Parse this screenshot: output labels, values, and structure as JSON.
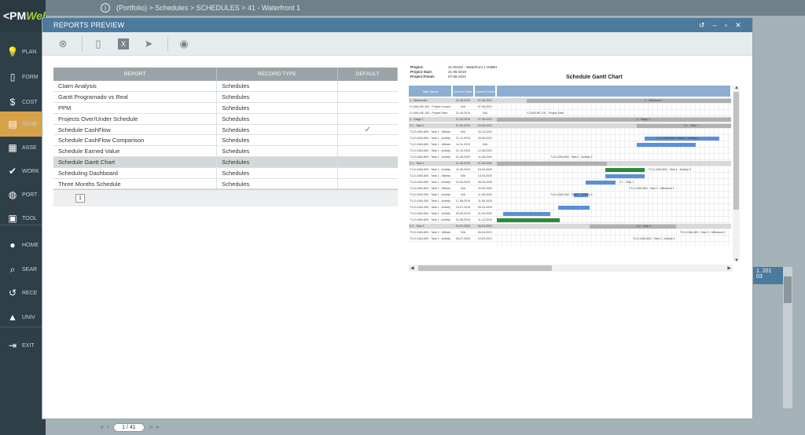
{
  "app": {
    "logo_left": "<PM",
    "logo_right": "Web",
    "breadcrumb": "(Portfolio) > Schedules > SCHEDULES > 41 - Waterfront 1"
  },
  "nav": [
    {
      "label": "PLAN",
      "icon": "lightbulb-icon",
      "glyph": "💡"
    },
    {
      "label": "FORM",
      "icon": "document-icon",
      "glyph": "▯"
    },
    {
      "label": "COST",
      "icon": "dollar-icon",
      "glyph": "$"
    },
    {
      "label": "SCHE",
      "icon": "schedule-icon",
      "glyph": "▤"
    },
    {
      "label": "ASSE",
      "icon": "asset-icon",
      "glyph": "▦"
    },
    {
      "label": "WORK",
      "icon": "checkmark-icon",
      "glyph": "✔"
    },
    {
      "label": "PORT",
      "icon": "globe-icon",
      "glyph": "◍"
    },
    {
      "label": "TOOL",
      "icon": "toolbox-icon",
      "glyph": "▣"
    },
    {
      "label": "HOME",
      "icon": "avatar-icon",
      "glyph": "●"
    },
    {
      "label": "SEAR",
      "icon": "search-icon",
      "glyph": "⌕"
    },
    {
      "label": "RECE",
      "icon": "history-icon",
      "glyph": "↺"
    },
    {
      "label": "UNIV",
      "icon": "graduation-icon",
      "glyph": "▲"
    },
    {
      "label": "EXIT",
      "icon": "exit-icon",
      "glyph": "⇥"
    }
  ],
  "background": {
    "pager_text": "1 / 41",
    "grid_cell_top": "1. 201",
    "grid_cell_bottom": "03"
  },
  "modal": {
    "title": "REPORTS PREVIEW",
    "window_controls": [
      "↺",
      "–",
      "▫",
      "✕"
    ],
    "toolbar": [
      {
        "name": "cancel-icon",
        "glyph": "⊗"
      },
      {
        "name": "pdf-icon",
        "glyph": "▯"
      },
      {
        "name": "excel-icon",
        "glyph": "X"
      },
      {
        "name": "send-icon",
        "glyph": "➤"
      },
      {
        "name": "preview-eye-icon",
        "glyph": "◉"
      }
    ]
  },
  "reports_table": {
    "headers": [
      "REPORT",
      "RECORD TYPE",
      "DEFAULT"
    ],
    "rows": [
      {
        "report": "Claim Analysis",
        "type": "Schedules",
        "default": ""
      },
      {
        "report": "Gantt Programado vs Real",
        "type": "Schedules",
        "default": ""
      },
      {
        "report": "PPM",
        "type": "Schedules",
        "default": ""
      },
      {
        "report": "Projects Over/Under Schedule",
        "type": "Schedules",
        "default": ""
      },
      {
        "report": "Schedule CashFlow",
        "type": "Schedules",
        "default": "✓"
      },
      {
        "report": "Schedule CashFlow Comparison",
        "type": "Schedules",
        "default": ""
      },
      {
        "report": "Schedule Earned Value",
        "type": "Schedules",
        "default": ""
      },
      {
        "report": "Schedule Gantt Chart",
        "type": "Schedules",
        "default": ""
      },
      {
        "report": "Scheduling Dashboard",
        "type": "Schedules",
        "default": ""
      },
      {
        "report": "Three Months Schedule",
        "type": "Schedules",
        "default": ""
      }
    ],
    "selected_index": 7,
    "page": "1"
  },
  "preview": {
    "meta": [
      {
        "label": "Project:",
        "value": "41-00162 - Waterfront 1 GMBH"
      },
      {
        "label": "Project Start:",
        "value": "21-05-2019"
      },
      {
        "label": "Project Finish:",
        "value": "07-08-2021"
      }
    ],
    "title": "Schedule Gantt Chart",
    "col_headers": [
      "Task Name",
      "Current Start",
      "Current Finish"
    ],
    "rows": [
      {
        "name": "1 - Milestones",
        "start": "21-05-2019",
        "finish": "07-08-2021",
        "group": true
      },
      {
        "name": "G-GAN-NE-100 - Project Completion",
        "start": "N/A",
        "finish": "07-08-2021",
        "group": false
      },
      {
        "name": "G-GAN-NE-100 - Project Start",
        "start": "21-05-2019",
        "finish": "N/A",
        "group": false
      },
      {
        "name": "2 - Stage 1",
        "start": "27-02-2019",
        "finish": "07-08-2021",
        "group": true
      },
      {
        "name": "2.1 - Task 1",
        "start": "21-02-2019",
        "finish": "04-05-2021",
        "group": true
      },
      {
        "name": "T1-D-GAN-800 - Task 1 - Milestone 1",
        "start": "N/A",
        "finish": "22-12-2021",
        "group": false
      },
      {
        "name": "T1-D-GAN-800 - Task 1 - Activity 1",
        "start": "21-11-2019",
        "finish": "25-06-2021",
        "group": false
      },
      {
        "name": "T1-D-GAN-800 - Task 1 - Milestone 2",
        "start": "14-11-2019",
        "finish": "N/A",
        "group": false
      },
      {
        "name": "T1-D-GAN-800 - Task 1 - Activity 2",
        "start": "01-10-2020",
        "finish": "12-08-2020",
        "group": false
      },
      {
        "name": "T1-D-GAN-800 - Task 1 - Activity 3",
        "start": "01-05-2020",
        "finish": "11-06-2020",
        "group": false
      },
      {
        "name": "2.1 - Task 1",
        "start": "21-05-2019",
        "finish": "07-08-2020",
        "group": true
      },
      {
        "name": "T1-D-GAN-800 - Task 1 - Activity 1",
        "start": "11-09-2019",
        "finish": "16-04-2020",
        "group": false
      },
      {
        "name": "T1-D-GAN-800 - Task 1 - Milestone 1",
        "start": "N/A",
        "finish": "14-04-2020",
        "group": false
      },
      {
        "name": "T1-D-GAN-800 - Task 1 - Activity 2",
        "start": "10-04-2020",
        "finish": "08-05-2020",
        "group": false
      },
      {
        "name": "T1-D-GAN-800 - Task 1 - Milestone 2",
        "start": "N/A",
        "finish": "29-05-2020",
        "group": false
      },
      {
        "name": "T1-D-GAN-300 - Task 1 - Activity 4",
        "start": "N/A",
        "finish": "11-05-2020",
        "group": false
      },
      {
        "name": "T1-D-GAN-300 - Task 1 - Activity 5",
        "start": "17-08-2019",
        "finish": "11-06-2020",
        "group": false
      },
      {
        "name": "T1-D-GAN-300 - Task 1 - Activity 3",
        "start": "19-07-2019",
        "finish": "09-04-2020",
        "group": false
      },
      {
        "name": "T1-D-GAN-800 - Task 1 - Activity 6",
        "start": "09-09-2019",
        "finish": "21-04-2020",
        "group": false
      },
      {
        "name": "T1-D-GAN-800 - Task 1 - Activity 1",
        "start": "21-08-2019",
        "finish": "11-10-2019",
        "group": false
      },
      {
        "name": "2.2 - Task 2",
        "start": "02-01-2020",
        "finish": "06-04-2021",
        "group": true
      },
      {
        "name": "T2-D-GAN-800 - Task 2 - Milestone 2",
        "start": "N/A",
        "finish": "06-04-2021",
        "group": false
      },
      {
        "name": "T2-D-GAN-800 - Task 2 - Activity 4",
        "start": "08-07-2020",
        "finish": "10-03-2021",
        "group": false
      }
    ],
    "gantt_labels": [
      "1 - Milestones",
      "G-GAN-NE-100 - Project Start",
      "2 - Stage 1",
      "2.1 - Task 1",
      "T1-D-GAN-800 - Task 1 - Activity 1",
      "T1-D-GAN-800 - Task 1 - Activity 2",
      "T1-D-GAN-800 - Task 1 - Activity 3",
      "2.1 - Task 1",
      "T1-D-GAN-800 - Task 1 - Milestone 1",
      "T1-D-GAN-300 - Task 1 - Activity 4",
      "2.2 - Task 2",
      "T2-D-GAN-800 - Task 2 - Milestone 2",
      "T2-D-GAN-800 - Task 2 - Activity 4"
    ],
    "colors": {
      "header_blue": "#8daed0",
      "bar_blue": "#5b8fd8",
      "bar_gray": "#b0b0b0",
      "bar_green": "#2c8a3a"
    }
  }
}
